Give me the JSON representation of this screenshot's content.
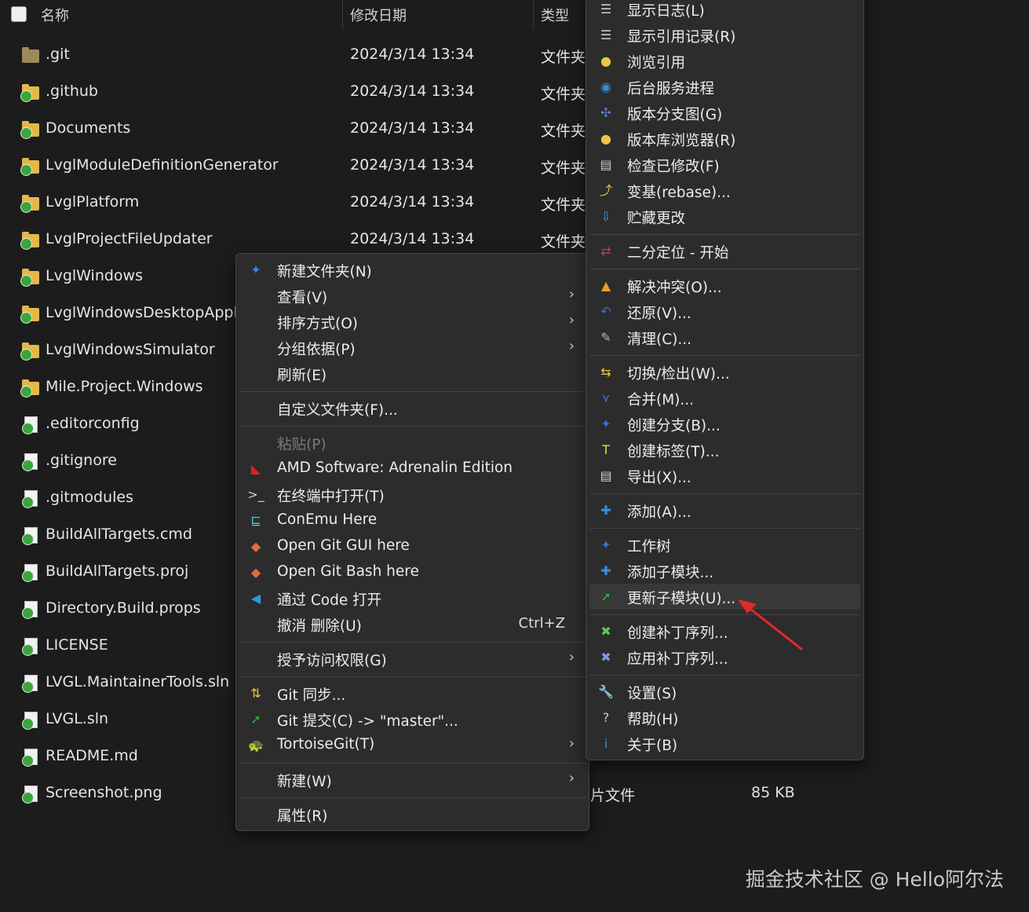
{
  "header": {
    "name_col": "名称",
    "date_col": "修改日期",
    "type_col": "类型"
  },
  "files": [
    {
      "name": ".git",
      "date": "2024/3/14 13:34",
      "type": "文件夹",
      "icon": "folder-icon"
    },
    {
      "name": ".github",
      "date": "2024/3/14 13:34",
      "type": "文件夹",
      "icon": "git-folder-icon"
    },
    {
      "name": "Documents",
      "date": "2024/3/14 13:34",
      "type": "文件夹",
      "icon": "git-folder-icon"
    },
    {
      "name": "LvglModuleDefinitionGenerator",
      "date": "2024/3/14 13:34",
      "type": "文件夹",
      "icon": "git-folder-icon"
    },
    {
      "name": "LvglPlatform",
      "date": "2024/3/14 13:34",
      "type": "文件夹",
      "icon": "git-folder-icon"
    },
    {
      "name": "LvglProjectFileUpdater",
      "date": "2024/3/14 13:34",
      "type": "文件夹",
      "icon": "git-folder-icon"
    },
    {
      "name": "LvglWindows",
      "date": "",
      "type": "",
      "icon": "git-folder-icon"
    },
    {
      "name": "LvglWindowsDesktopApplic",
      "date": "",
      "type": "",
      "icon": "git-folder-icon"
    },
    {
      "name": "LvglWindowsSimulator",
      "date": "",
      "type": "",
      "icon": "git-folder-icon"
    },
    {
      "name": "Mile.Project.Windows",
      "date": "",
      "type": "",
      "icon": "git-folder-icon"
    },
    {
      "name": ".editorconfig",
      "date": "",
      "type": "",
      "icon": "git-file-icon"
    },
    {
      "name": ".gitignore",
      "date": "",
      "type": "",
      "icon": "git-file-icon"
    },
    {
      "name": ".gitmodules",
      "date": "",
      "type": "",
      "icon": "git-file-icon"
    },
    {
      "name": "BuildAllTargets.cmd",
      "date": "",
      "type": "",
      "icon": "git-file-icon"
    },
    {
      "name": "BuildAllTargets.proj",
      "date": "",
      "type": "",
      "icon": "git-file-icon"
    },
    {
      "name": "Directory.Build.props",
      "date": "",
      "type": "",
      "icon": "git-file-icon"
    },
    {
      "name": "LICENSE",
      "date": "",
      "type": "",
      "icon": "git-file-icon"
    },
    {
      "name": "LVGL.MaintainerTools.sln",
      "date": "",
      "type": "",
      "icon": "git-file-icon"
    },
    {
      "name": "LVGL.sln",
      "date": "",
      "type": "",
      "icon": "git-file-icon"
    },
    {
      "name": "README.md",
      "date": "",
      "type": "",
      "icon": "git-file-icon"
    },
    {
      "name": "Screenshot.png",
      "date": "",
      "type": "",
      "icon": "git-file-icon"
    }
  ],
  "behind_rows": {
    "screenshot_type": "片文件",
    "screenshot_size": "85 KB"
  },
  "context_menu": {
    "items": [
      {
        "label": "新建文件夹(N)",
        "icon": "new-folder-icon",
        "glyph": "✦",
        "color": "#3b82f6"
      },
      {
        "label": "查看(V)",
        "arrow": "›"
      },
      {
        "label": "排序方式(O)",
        "arrow": "›"
      },
      {
        "label": "分组依据(P)",
        "arrow": "›"
      },
      {
        "label": "刷新(E)"
      },
      {
        "label": "自定义文件夹(F)..."
      },
      {
        "label": "粘贴(P)",
        "disabled": true
      },
      {
        "label": "AMD Software: Adrenalin Edition",
        "icon": "amd-icon",
        "glyph": "◣",
        "color": "#e02020"
      },
      {
        "label": "在终端中打开(T)",
        "icon": "terminal-icon",
        "glyph": ">_",
        "color": "#cfcfcf"
      },
      {
        "label": "ConEmu Here",
        "icon": "conemu-icon",
        "glyph": "⊑",
        "color": "#4fc3d9"
      },
      {
        "label": "Open Git GUI here",
        "icon": "git-gui-icon",
        "glyph": "◆",
        "color": "#e26a3c"
      },
      {
        "label": "Open Git Bash here",
        "icon": "git-bash-icon",
        "glyph": "◆",
        "color": "#e26a3c"
      },
      {
        "label": "通过 Code 打开",
        "icon": "vscode-icon",
        "glyph": "◀",
        "color": "#2b9ae5"
      },
      {
        "label": "撤消 删除(U)",
        "shortcut": "Ctrl+Z"
      },
      {
        "label": "授予访问权限(G)",
        "arrow": "›"
      },
      {
        "label": "Git 同步...",
        "icon": "git-sync-icon",
        "glyph": "⇅",
        "color": "#e8c840"
      },
      {
        "label": "Git 提交(C) -> \"master\"...",
        "icon": "git-commit-icon",
        "glyph": "➚",
        "color": "#3ab03a"
      },
      {
        "label": "TortoiseGit(T)",
        "icon": "tortoisegit-icon",
        "glyph": "🐢",
        "color": "#e8c840",
        "arrow": "›"
      },
      {
        "label": "新建(W)",
        "arrow": "›"
      },
      {
        "label": "属性(R)"
      }
    ]
  },
  "tortoise_menu": {
    "items": [
      {
        "label": "显示日志(L)",
        "icon": "show-log-icon",
        "glyph": "☰",
        "color": "#cfcfcf"
      },
      {
        "label": "显示引用记录(R)",
        "icon": "reflog-icon",
        "glyph": "☰",
        "color": "#cfcfcf"
      },
      {
        "label": "浏览引用",
        "icon": "browse-refs-icon",
        "glyph": "●",
        "color": "#e8c840"
      },
      {
        "label": "后台服务进程",
        "icon": "daemon-icon",
        "glyph": "◉",
        "color": "#3a8fd8"
      },
      {
        "label": "版本分支图(G)",
        "icon": "revision-graph-icon",
        "glyph": "✣",
        "color": "#5a7fd8"
      },
      {
        "label": "版本库浏览器(R)",
        "icon": "repo-browser-icon",
        "glyph": "●",
        "color": "#e8c840"
      },
      {
        "label": "检查已修改(F)",
        "icon": "check-modifications-icon",
        "glyph": "▤",
        "color": "#cfcfcf"
      },
      {
        "label": "变基(rebase)...",
        "icon": "rebase-icon",
        "glyph": "⤴",
        "color": "#e8c840"
      },
      {
        "label": "贮藏更改",
        "icon": "stash-icon",
        "glyph": "⇩",
        "color": "#3a9ae0"
      },
      {
        "label": "二分定位 - 开始",
        "icon": "bisect-icon",
        "glyph": "⇄",
        "color": "#d03a3a"
      },
      {
        "label": "解决冲突(O)...",
        "icon": "resolve-icon",
        "glyph": "▲",
        "color": "#e8a020"
      },
      {
        "label": "还原(V)...",
        "icon": "revert-icon",
        "glyph": "↶",
        "color": "#3a6fd8"
      },
      {
        "label": "清理(C)...",
        "icon": "cleanup-icon",
        "glyph": "✎",
        "color": "#c8a0e8"
      },
      {
        "label": "切换/检出(W)...",
        "icon": "switch-icon",
        "glyph": "⇆",
        "color": "#e8c840"
      },
      {
        "label": "合并(M)...",
        "icon": "merge-icon",
        "glyph": "⋎",
        "color": "#3a6fd8"
      },
      {
        "label": "创建分支(B)...",
        "icon": "branch-icon",
        "glyph": "✦",
        "color": "#3a6fd8"
      },
      {
        "label": "创建标签(T)...",
        "icon": "tag-icon",
        "glyph": "T",
        "color": "#e8e020"
      },
      {
        "label": "导出(X)...",
        "icon": "export-icon",
        "glyph": "▤",
        "color": "#cfcfcf"
      },
      {
        "label": "添加(A)...",
        "icon": "add-icon",
        "glyph": "✚",
        "color": "#3a8fe0"
      },
      {
        "label": "工作树",
        "icon": "worktree-icon",
        "glyph": "✦",
        "color": "#3a6fd8"
      },
      {
        "label": "添加子模块...",
        "icon": "add-submodule-icon",
        "glyph": "✚",
        "color": "#3a8fe0"
      },
      {
        "label": "更新子模块(U)...",
        "icon": "update-submodule-icon",
        "glyph": "➚",
        "color": "#3ab03a",
        "highlight": true
      },
      {
        "label": "创建补丁序列...",
        "icon": "create-patch-icon",
        "glyph": "✖",
        "color": "#5ac85a"
      },
      {
        "label": "应用补丁序列...",
        "icon": "apply-patch-icon",
        "glyph": "✖",
        "color": "#7a9ae0"
      },
      {
        "label": "设置(S)",
        "icon": "settings-icon",
        "glyph": "🔧",
        "color": "#cfcfcf"
      },
      {
        "label": "帮助(H)",
        "icon": "help-icon",
        "glyph": "?",
        "color": "#cfcfcf"
      },
      {
        "label": "关于(B)",
        "icon": "about-icon",
        "glyph": "i",
        "color": "#3a8fe0"
      }
    ]
  },
  "watermark": "掘金技术社区 @ Hello阿尔法",
  "annotation_arrow_color": "#e02a2a"
}
